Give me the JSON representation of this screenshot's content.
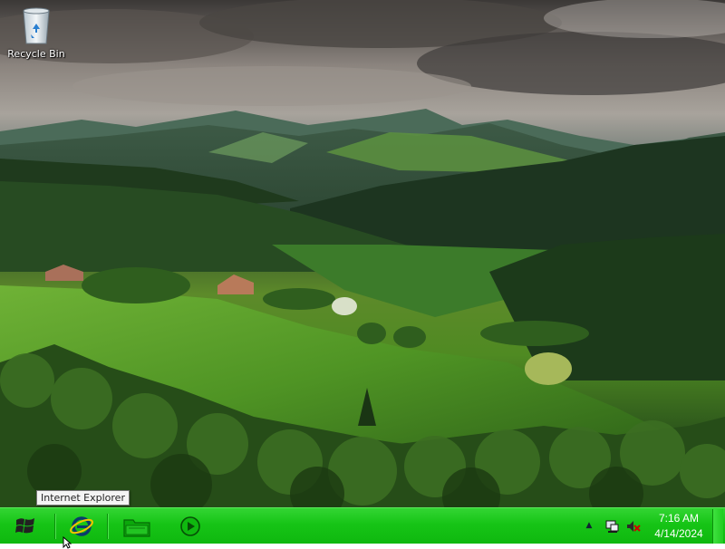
{
  "desktop": {
    "recycle_bin_label": "Recycle Bin",
    "tooltip_text": "Internet Explorer"
  },
  "taskbar": {
    "colors": {
      "bar": "#16c416",
      "bar_light": "#33d533"
    },
    "pinned": [
      {
        "name": "Internet Explorer",
        "icon": "internet-explorer-icon"
      },
      {
        "name": "Windows Explorer",
        "icon": "folder-icon"
      },
      {
        "name": "Windows Media Player",
        "icon": "media-player-icon"
      }
    ],
    "clock": {
      "time": "7:16 AM",
      "date": "4/14/2024"
    },
    "tray": {
      "chevron": "▲",
      "icons": [
        "network-icon",
        "volume-muted-icon"
      ]
    }
  }
}
